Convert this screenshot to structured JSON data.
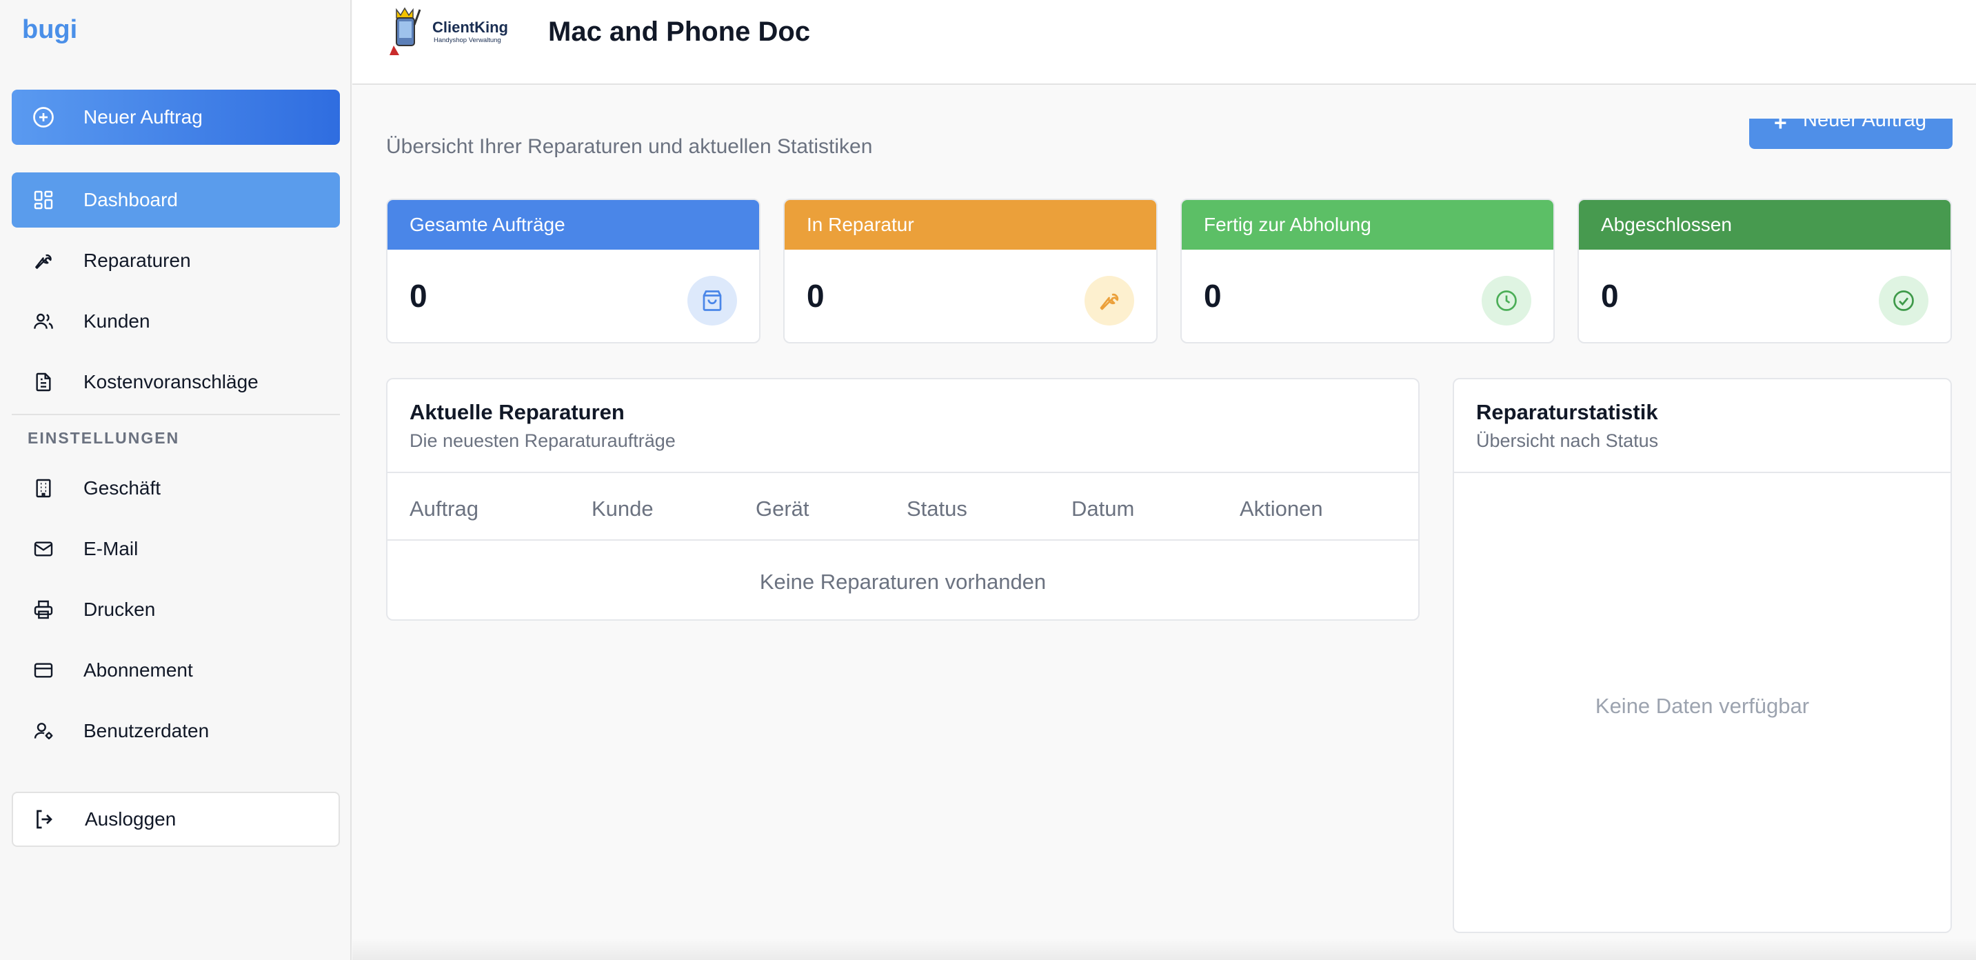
{
  "sidebar": {
    "brand": "bugi",
    "new_order_label": "Neuer Auftrag",
    "items": [
      {
        "label": "Dashboard",
        "icon": "dashboard-icon",
        "active": true
      },
      {
        "label": "Reparaturen",
        "icon": "wrench-icon"
      },
      {
        "label": "Kunden",
        "icon": "users-icon"
      },
      {
        "label": "Kostenvoranschläge",
        "icon": "document-icon"
      }
    ],
    "settings_heading": "EINSTELLUNGEN",
    "settings_items": [
      {
        "label": "Geschäft",
        "icon": "building-icon"
      },
      {
        "label": "E-Mail",
        "icon": "mail-icon"
      },
      {
        "label": "Drucken",
        "icon": "printer-icon"
      },
      {
        "label": "Abonnement",
        "icon": "credit-card-icon"
      },
      {
        "label": "Benutzerdaten",
        "icon": "user-settings-icon"
      }
    ],
    "logout_label": "Ausloggen"
  },
  "header": {
    "logo_text": "ClientKing",
    "logo_subtext": "Handyshop Verwaltung",
    "shop_name": "Mac and Phone Doc"
  },
  "main": {
    "subtitle": "Übersicht Ihrer Reparaturen und aktuellen Statistiken",
    "new_order_button": "Neuer Auftrag",
    "stats": [
      {
        "label": "Gesamte Aufträge",
        "value": "0",
        "color": "#4a86e8",
        "icon": "shopping-bag-icon"
      },
      {
        "label": "In Reparatur",
        "value": "0",
        "color": "#eba03a",
        "icon": "wrench-icon"
      },
      {
        "label": "Fertig zur Abholung",
        "value": "0",
        "color": "#5cbf66",
        "icon": "clock-icon"
      },
      {
        "label": "Abgeschlossen",
        "value": "0",
        "color": "#479a4f",
        "icon": "check-circle-icon"
      }
    ],
    "repairs": {
      "title": "Aktuelle Reparaturen",
      "subtitle": "Die neuesten Reparaturaufträge",
      "columns": [
        "Auftrag",
        "Kunde",
        "Gerät",
        "Status",
        "Datum",
        "Aktionen"
      ],
      "empty_text": "Keine Reparaturen vorhanden"
    },
    "stats_panel": {
      "title": "Reparaturstatistik",
      "subtitle": "Übersicht nach Status",
      "empty_text": "Keine Daten verfügbar"
    }
  }
}
